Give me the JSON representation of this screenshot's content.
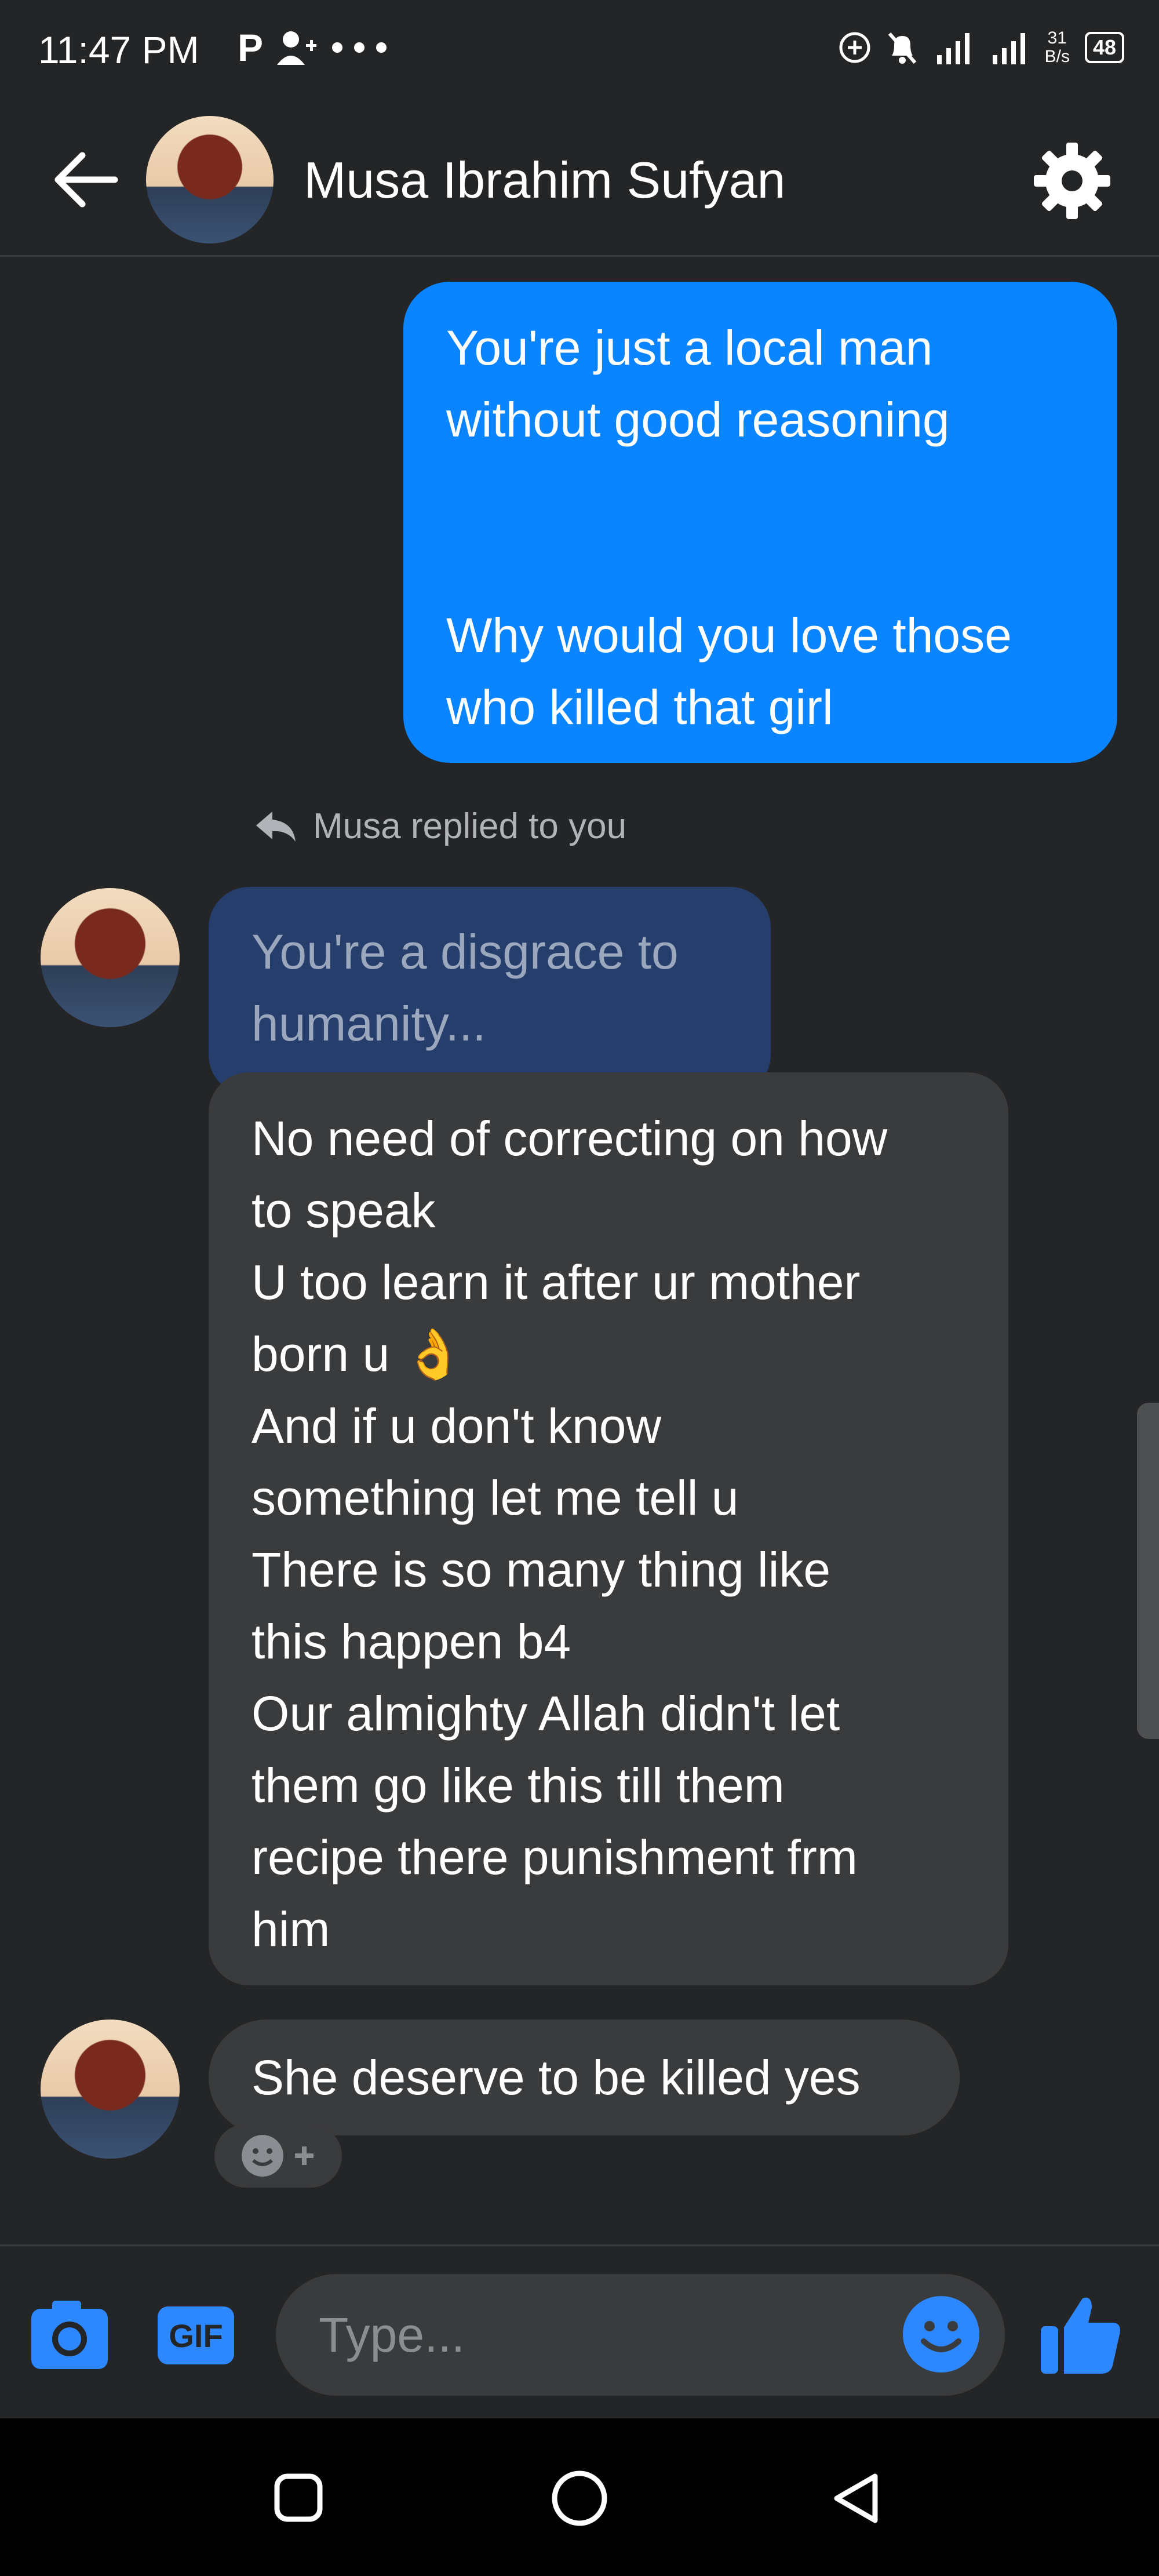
{
  "status_bar": {
    "time": "11:47 PM",
    "notification_icons": [
      "P",
      "person-add-icon",
      "more-dots-icon"
    ],
    "speed_value": "31",
    "speed_unit": "B/s",
    "battery": "48"
  },
  "header": {
    "contact_name": "Musa Ibrahim Sufyan"
  },
  "messages": {
    "sent": "You're just a local man\nwithout good reasoning\n\n\nWhy would you love those\nwho killed that girl",
    "reply_label": "Musa replied to you",
    "quoted": "You're a disgrace to\nhumanity...",
    "received_1": "No need of correcting on how\nto speak\nU too learn it after ur mother\nborn u 👌\nAnd if u don't know\nsomething let me tell u\nThere is so many thing like\nthis happen b4\nOur almighty Allah didn't let\nthem go like this till them\nrecipe there punishment frm\nhim",
    "received_2": "She deserve to be killed yes"
  },
  "composer": {
    "placeholder": "Type...",
    "gif_label": "GIF"
  },
  "colors": {
    "background": "#242526",
    "sent_bubble": "#0a84ff",
    "received_bubble": "#3a3b3c",
    "accent": "#2d88ff"
  }
}
